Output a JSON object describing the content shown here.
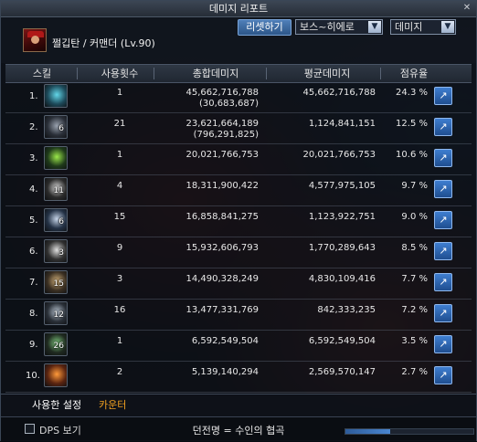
{
  "window": {
    "title": "데미지 리포트"
  },
  "character": {
    "name": "쩔깁탄 / 커맨더 (Lv.90)"
  },
  "controls": {
    "reset_label": "리셋하기",
    "target_dropdown": "보스~히에로",
    "metric_dropdown": "데미지"
  },
  "columns": {
    "skill": "스킬",
    "uses": "사용횟수",
    "total": "총합데미지",
    "avg": "평균데미지",
    "share": "점유율"
  },
  "rows": [
    {
      "rank": "1.",
      "level": "",
      "uses": "1",
      "total": "45,662,716,788",
      "total_sub": "(30,683,687)",
      "avg": "45,662,716,788",
      "share": "24.3 %",
      "icon_color": "#1d4a5a",
      "icon_accent": "#62d6e8"
    },
    {
      "rank": "2.",
      "level": "6",
      "uses": "21",
      "total": "23,621,664,189",
      "total_sub": "(796,291,825)",
      "avg": "1,124,841,151",
      "share": "12.5 %",
      "icon_color": "#2a2f38",
      "icon_accent": "#9aa3b0"
    },
    {
      "rank": "3.",
      "level": "",
      "uses": "1",
      "total": "20,021,766,753",
      "total_sub": "",
      "avg": "20,021,766,753",
      "share": "10.6 %",
      "icon_color": "#1f3a1a",
      "icon_accent": "#9be84a"
    },
    {
      "rank": "4.",
      "level": "11",
      "uses": "4",
      "total": "18,311,900,422",
      "total_sub": "",
      "avg": "4,577,975,105",
      "share": "9.7 %",
      "icon_color": "#2b2b2b",
      "icon_accent": "#d8d8d8"
    },
    {
      "rank": "5.",
      "level": "6",
      "uses": "15",
      "total": "16,858,841,275",
      "total_sub": "",
      "avg": "1,123,922,751",
      "share": "9.0 %",
      "icon_color": "#243246",
      "icon_accent": "#c7d6ea"
    },
    {
      "rank": "6.",
      "level": "3",
      "uses": "9",
      "total": "15,932,606,793",
      "total_sub": "",
      "avg": "1,770,289,643",
      "share": "8.5 %",
      "icon_color": "#303030",
      "icon_accent": "#e0e0e0"
    },
    {
      "rank": "7.",
      "level": "15",
      "uses": "3",
      "total": "14,490,328,249",
      "total_sub": "",
      "avg": "4,830,109,416",
      "share": "7.7 %",
      "icon_color": "#3a2f22",
      "icon_accent": "#d2b07a"
    },
    {
      "rank": "8.",
      "level": "12",
      "uses": "16",
      "total": "13,477,331,769",
      "total_sub": "",
      "avg": "842,333,235",
      "share": "7.2 %",
      "icon_color": "#2a3038",
      "icon_accent": "#b8c4d2"
    },
    {
      "rank": "9.",
      "level": "26",
      "uses": "1",
      "total": "6,592,549,504",
      "total_sub": "",
      "avg": "6,592,549,504",
      "share": "3.5 %",
      "icon_color": "#1f2a20",
      "icon_accent": "#7ec87e"
    },
    {
      "rank": "10.",
      "level": "",
      "uses": "2",
      "total": "5,139,140,294",
      "total_sub": "",
      "avg": "2,569,570,147",
      "share": "2.7 %",
      "icon_color": "#5a2410",
      "icon_accent": "#ff9a3a"
    }
  ],
  "tabs": {
    "settings": "사용한 설정",
    "counter": "카운터"
  },
  "footer": {
    "dps_label": "DPS 보기",
    "dungeon": "던전명 = 수인의 협곡",
    "progress_fraction": 0.35
  }
}
